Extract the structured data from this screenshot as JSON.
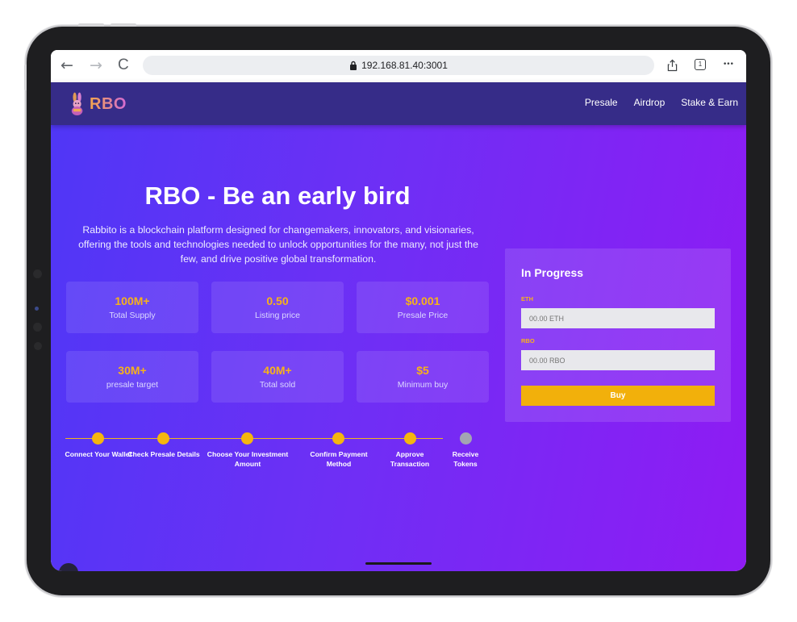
{
  "browser": {
    "url": "192.168.81.40:3001",
    "tab_count": "1",
    "back_glyph": "←",
    "forward_glyph": "→",
    "reload_glyph": "C",
    "more_glyph": "•••"
  },
  "nav": {
    "brand": "RBO",
    "links": [
      "Presale",
      "Airdrop",
      "Stake & Earn"
    ]
  },
  "hero": {
    "title": "RBO - Be an early bird",
    "description": "Rabbito is a blockchain platform designed for changemakers, innovators, and visionaries, offering the tools and technologies needed to unlock opportunities for the many, not just the few, and drive positive global transformation."
  },
  "stats": [
    {
      "value": "100M+",
      "label": "Total Supply"
    },
    {
      "value": "0.50",
      "label": "Listing price"
    },
    {
      "value": "$0.001",
      "label": "Presale Price"
    },
    {
      "value": "30M+",
      "label": "presale target"
    },
    {
      "value": "40M+",
      "label": "Total sold"
    },
    {
      "value": "$5",
      "label": "Minimum buy"
    }
  ],
  "steps": [
    {
      "label": "Connect Your Wallet",
      "done": true
    },
    {
      "label": "Check Presale Details",
      "done": true
    },
    {
      "label": "Choose Your Investment Amount",
      "done": true
    },
    {
      "label": "Confirm Payment Method",
      "done": true
    },
    {
      "label": "Approve Transaction",
      "done": true
    },
    {
      "label": "Receive Tokens",
      "done": false
    }
  ],
  "presale_card": {
    "title": "In Progress",
    "eth_label": "ETH",
    "eth_placeholder": "00.00 ETH",
    "rbo_label": "RBO",
    "rbo_placeholder": "00.00 RBO",
    "buy_label": "Buy"
  },
  "colors": {
    "accent": "#f5b60f",
    "gradient_start": "#4f37f6",
    "gradient_end": "#8f1bf3",
    "navbar": "#362c88"
  }
}
